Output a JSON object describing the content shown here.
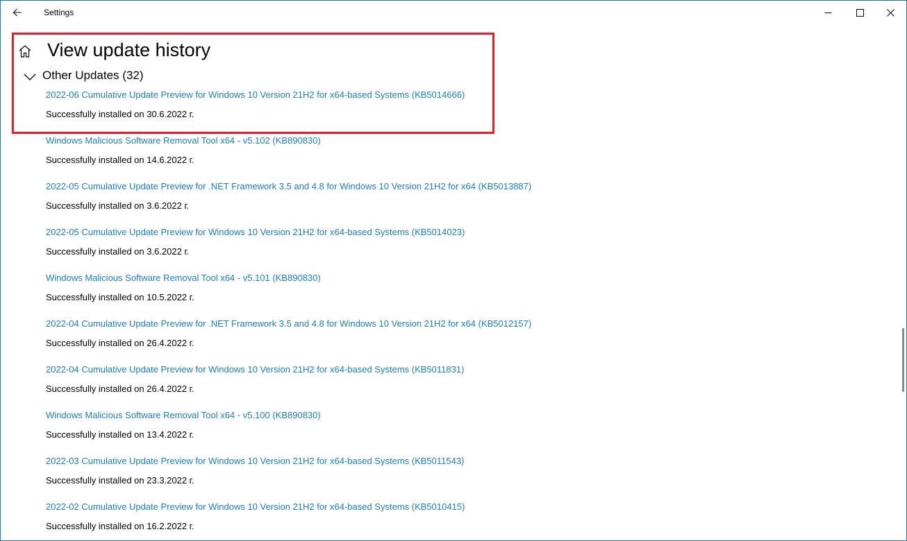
{
  "window": {
    "title": "Settings",
    "accent_color": "#1f6fbf"
  },
  "page": {
    "title": "View update history"
  },
  "section": {
    "label": "Other Updates (32)",
    "expanded": true
  },
  "highlight": {
    "color": "#e51f2a"
  },
  "link_color": "#1a7fc1",
  "updates": [
    {
      "name": "2022-06 Cumulative Update Preview for Windows 10 Version 21H2 for x64-based Systems (KB5014666)",
      "status": "Successfully installed on 30.6.2022 г."
    },
    {
      "name": "Windows Malicious Software Removal Tool x64 - v5.102 (KB890830)",
      "status": "Successfully installed on 14.6.2022 г."
    },
    {
      "name": "2022-05 Cumulative Update Preview for .NET Framework 3.5 and 4.8 for Windows 10 Version 21H2 for x64 (KB5013887)",
      "status": "Successfully installed on 3.6.2022 г."
    },
    {
      "name": "2022-05 Cumulative Update Preview for Windows 10 Version 21H2 for x64-based Systems (KB5014023)",
      "status": "Successfully installed on 3.6.2022 г."
    },
    {
      "name": "Windows Malicious Software Removal Tool x64 - v5.101 (KB890830)",
      "status": "Successfully installed on 10.5.2022 г."
    },
    {
      "name": "2022-04 Cumulative Update Preview for .NET Framework 3.5 and 4.8 for Windows 10 Version 21H2 for x64 (KB5012157)",
      "status": "Successfully installed on 26.4.2022 г."
    },
    {
      "name": "2022-04 Cumulative Update Preview for Windows 10 Version 21H2 for x64-based Systems (KB5011831)",
      "status": "Successfully installed on 26.4.2022 г."
    },
    {
      "name": "Windows Malicious Software Removal Tool x64 - v5.100 (KB890830)",
      "status": "Successfully installed on 13.4.2022 г."
    },
    {
      "name": "2022-03 Cumulative Update Preview for Windows 10 Version 21H2 for x64-based Systems (KB5011543)",
      "status": "Successfully installed on 23.3.2022 г."
    },
    {
      "name": "2022-02 Cumulative Update Preview for Windows 10 Version 21H2 for x64-based Systems (KB5010415)",
      "status": "Successfully installed on 16.2.2022 г."
    }
  ]
}
